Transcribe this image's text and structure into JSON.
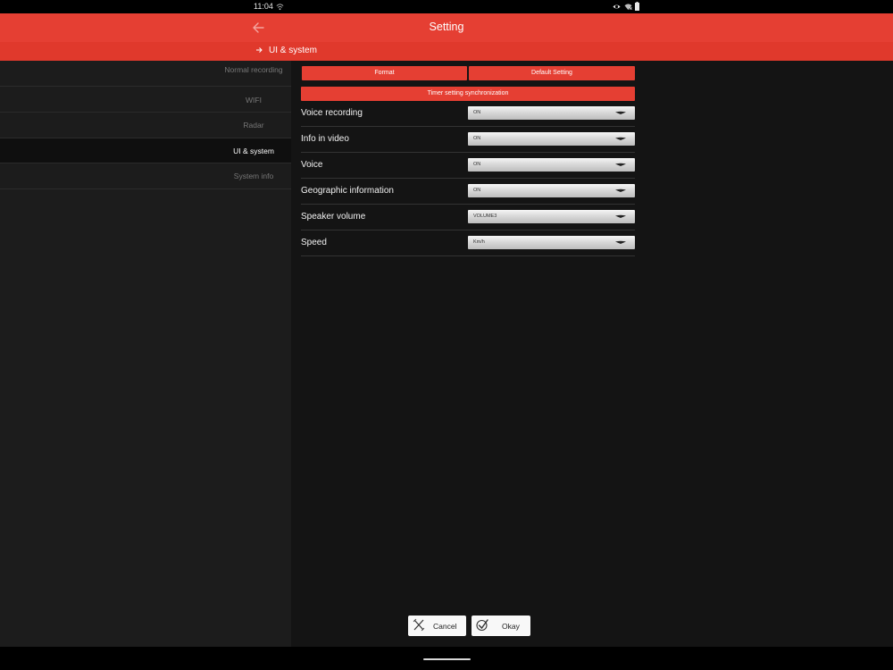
{
  "status_bar": {
    "time": "11:04",
    "icons": [
      "signal-icon",
      "eye-icon",
      "wifi-icon",
      "battery-icon"
    ]
  },
  "header": {
    "title": "Setting",
    "back_icon": "back-arrow-icon",
    "accent_color": "#e53f33"
  },
  "breadcrumb": {
    "label": "UI & system"
  },
  "sidebar": {
    "items": [
      {
        "label": "Normal recording",
        "active": false
      },
      {
        "label": "WIFI",
        "active": false
      },
      {
        "label": "Radar",
        "active": false
      },
      {
        "label": "UI & system",
        "active": true
      },
      {
        "label": "System info",
        "active": false
      }
    ]
  },
  "actions": {
    "format": "Format",
    "default_setting": "Default Setting",
    "timer_sync": "Timer setting synchronization"
  },
  "settings": [
    {
      "label": "Voice recording",
      "value": "ON"
    },
    {
      "label": "Info in video",
      "value": "ON"
    },
    {
      "label": "Voice",
      "value": "ON"
    },
    {
      "label": "Geographic information",
      "value": "ON"
    },
    {
      "label": "Speaker volume",
      "value": "VOLUME3"
    },
    {
      "label": "Speed",
      "value": "Km/h"
    }
  ],
  "footer": {
    "cancel": "Cancel",
    "okay": "Okay"
  }
}
